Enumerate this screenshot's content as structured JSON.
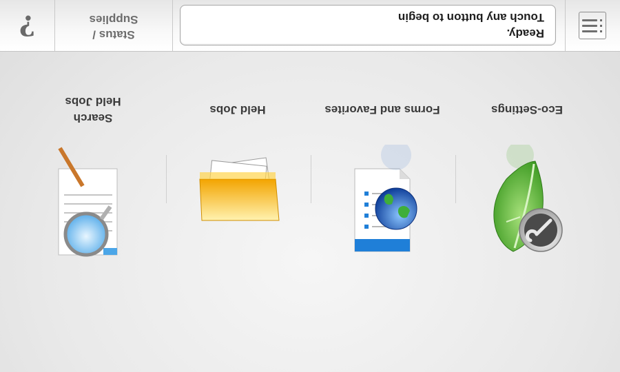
{
  "orientation": "upside-down",
  "header": {
    "message_line1": "Ready.",
    "message_line2": "Touch any button to begin",
    "status_label_line1": "Status /",
    "status_label_line2": "Supplies",
    "help_glyph": "?",
    "menu_icon": "menu-list-icon"
  },
  "tiles": [
    {
      "id": "eco",
      "label": "Eco-Settings",
      "icon": "eco-leaf-wrench-icon",
      "color": "#5bb33a"
    },
    {
      "id": "forms",
      "label": "Forms and Favorites",
      "icon": "forms-globe-icon",
      "color": "#1d64c8"
    },
    {
      "id": "held",
      "label": "Held Jobs",
      "icon": "folder-icon",
      "color": "#f3a400"
    },
    {
      "id": "search",
      "label_line1": "Search",
      "label_line2": "Held Jobs",
      "icon": "search-held-jobs-icon",
      "color": "#4ba6e8"
    }
  ]
}
